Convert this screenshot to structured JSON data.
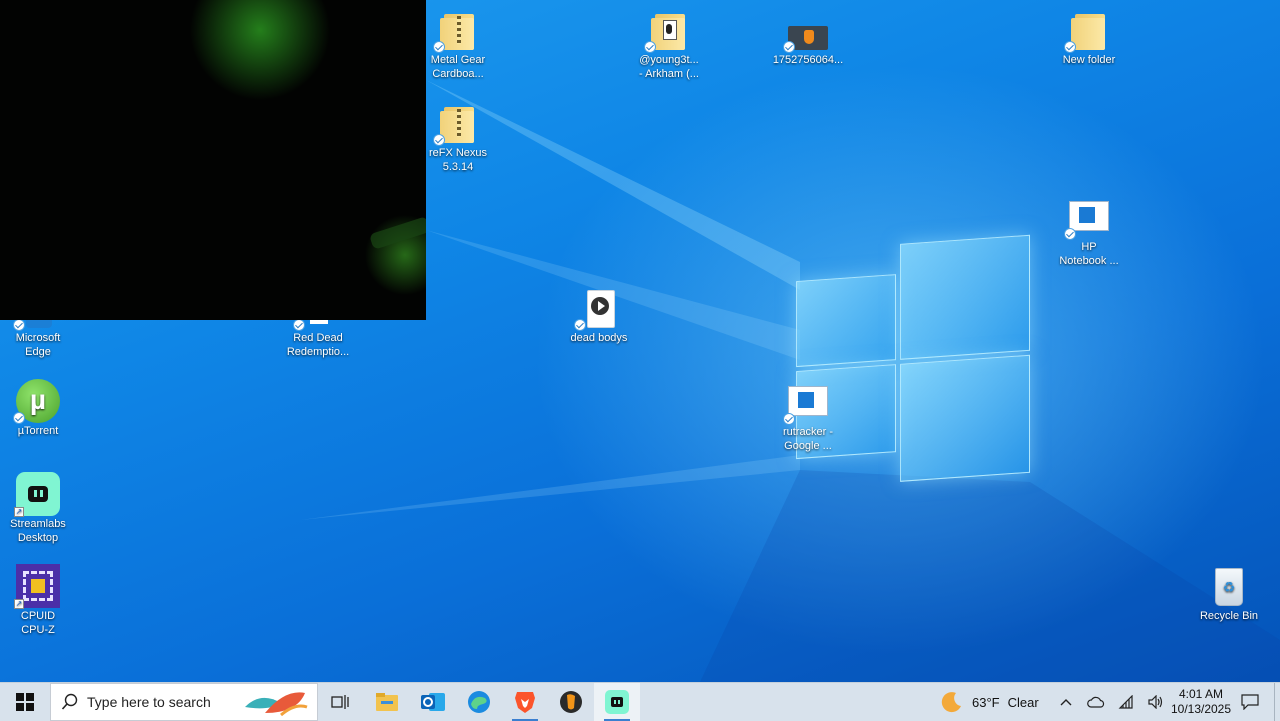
{
  "desktop": {
    "icons": [
      {
        "label": "Metal Gear\nCardboa..."
      },
      {
        "label": "reFX Nexus\n5.3.14"
      },
      {
        "label": "@young3t...\n- Arkham (..."
      },
      {
        "label": "1752756064..."
      },
      {
        "label": "New folder"
      },
      {
        "label": "HP\nNotebook ..."
      },
      {
        "label": "dead bodys"
      },
      {
        "label": "rutracker -\nGoogle ..."
      },
      {
        "label": "Microsoft\nEdge"
      },
      {
        "label": "Red Dead\nRedemptio..."
      },
      {
        "label": "µTorrent"
      },
      {
        "label": "Streamlabs\nDesktop"
      },
      {
        "label": "CPUID\nCPU-Z"
      },
      {
        "label": "Recycle Bin"
      }
    ]
  },
  "taskbar": {
    "search_placeholder": "Type here to search",
    "apps": [
      "task-view",
      "file-explorer",
      "outlook",
      "edge",
      "brave",
      "fl-studio",
      "streamlabs"
    ],
    "weather": {
      "temp": "63°F",
      "condition": "Clear"
    },
    "time": "4:01 AM",
    "date": "10/13/2025"
  },
  "colors": {
    "accent": "#0f86e6",
    "taskbar": "#d8e2ec"
  }
}
